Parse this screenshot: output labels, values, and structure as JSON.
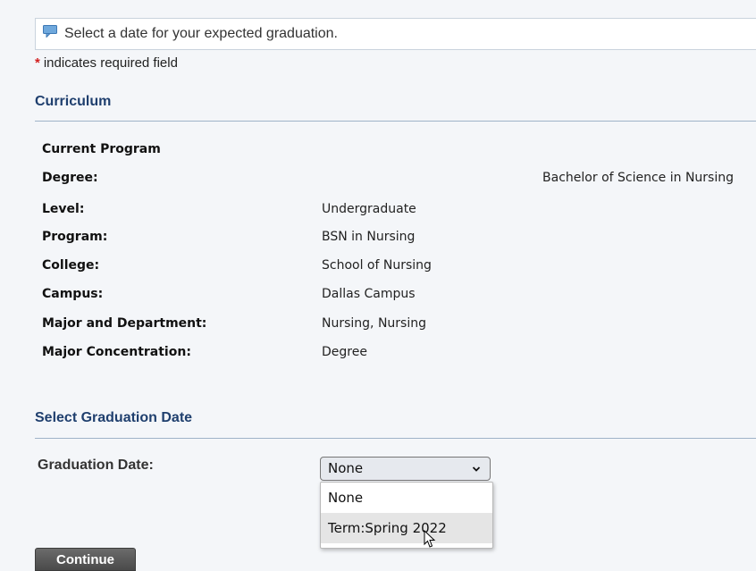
{
  "info": {
    "icon": "comment-icon",
    "message": "Select a date for your expected graduation."
  },
  "required_note": {
    "star": "*",
    "text": "indicates required field"
  },
  "curriculum": {
    "title": "Curriculum",
    "rows": [
      {
        "label": "Current Program",
        "value": ""
      },
      {
        "label": "Degree:",
        "value": "Bachelor of Science in Nursing"
      },
      {
        "label": "Level:",
        "value": "Undergraduate"
      },
      {
        "label": "Program:",
        "value": "BSN in Nursing"
      },
      {
        "label": "College:",
        "value": "School of Nursing"
      },
      {
        "label": "Campus:",
        "value": "Dallas Campus"
      },
      {
        "label": "Major and Department:",
        "value": "Nursing, Nursing"
      },
      {
        "label": "Major Concentration:",
        "value": "Degree"
      }
    ]
  },
  "graduation": {
    "title": "Select Graduation Date",
    "field_label": "Graduation Date:",
    "selected": "None",
    "options": [
      "None",
      "Term:Spring 2022"
    ],
    "highlighted_option": "Term:Spring 2022"
  },
  "actions": {
    "continue_label": "Continue"
  },
  "colors": {
    "section_title": "#1f3f6e",
    "required_star": "#d21f1f",
    "button_bg": "#555555"
  }
}
